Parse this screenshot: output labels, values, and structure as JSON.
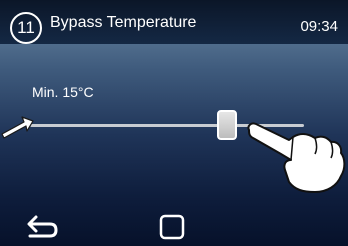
{
  "header": {
    "step_number": "11",
    "title": "Bypass Temperature",
    "time": "09:34"
  },
  "slider": {
    "min_label": "Min. 15°C",
    "value_fraction": 0.72
  },
  "footer": {
    "back_icon": "back-arrow-icon",
    "home_icon": "square-home-icon"
  },
  "colors": {
    "accent": "#ffffff",
    "background_top": "#6d8aa6",
    "background_bottom": "#06112a"
  }
}
